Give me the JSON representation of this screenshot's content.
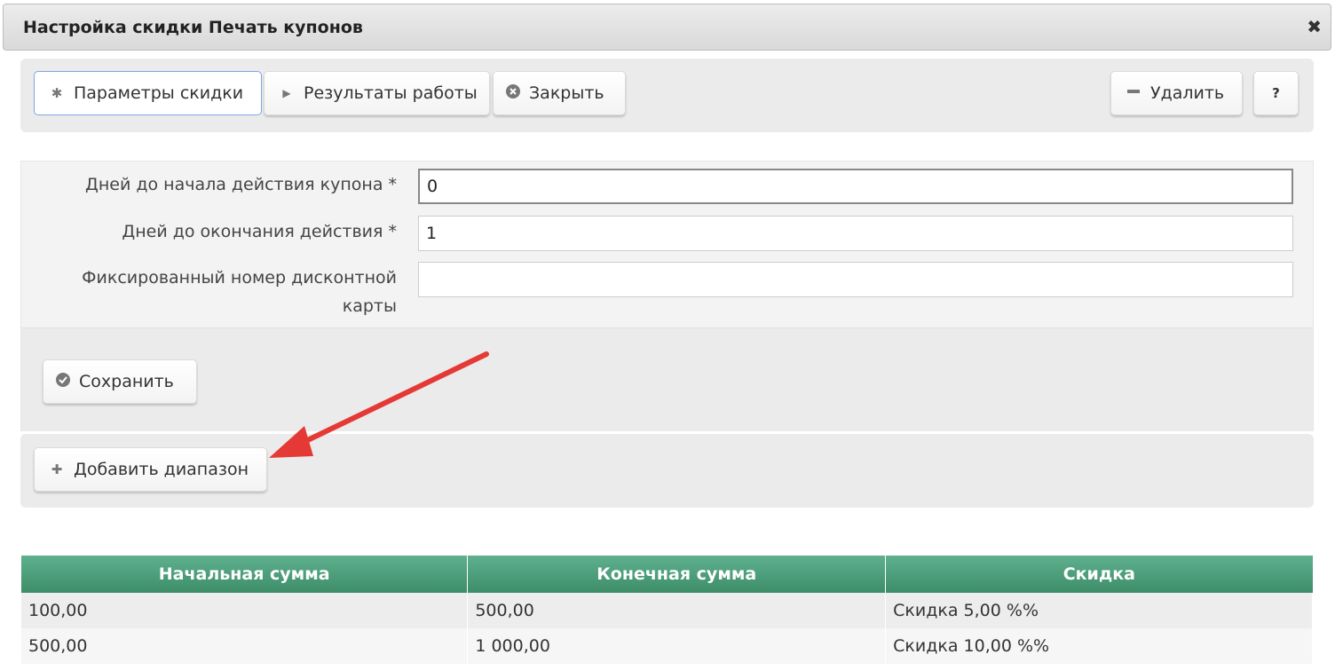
{
  "window": {
    "title": "Настройка скидки Печать купонов",
    "close_glyph": "✖"
  },
  "toolbar": {
    "params_label": "Параметры скидки",
    "params_icon": "gear-icon",
    "results_label": "Результаты работы",
    "results_icon": "play-icon",
    "close_label": "Закрыть",
    "close_icon": "close-circle-icon",
    "delete_label": "Удалить",
    "delete_icon": "minus-icon",
    "help_label": "?"
  },
  "form": {
    "days_start_label": "Дней до начала действия купона *",
    "days_start_value": "0",
    "days_end_label": "Дней до окончания действия *",
    "days_end_value": "1",
    "card_label_line1": "Фиксированный номер дисконтной",
    "card_label_line2": "карты",
    "card_value": "",
    "save_label": "Сохранить",
    "save_icon": "check-circle-icon"
  },
  "add_range": {
    "label": "Добавить диапазон",
    "icon": "plus-icon"
  },
  "annotation": {
    "arrow_color": "#e53935"
  },
  "table": {
    "header_color": "#4a9b77",
    "columns": [
      "Начальная сумма",
      "Конечная сумма",
      "Скидка"
    ],
    "rows": [
      [
        "100,00",
        "500,00",
        "Скидка 5,00 %%"
      ],
      [
        "500,00",
        "1 000,00",
        "Скидка 10,00 %%"
      ]
    ]
  }
}
